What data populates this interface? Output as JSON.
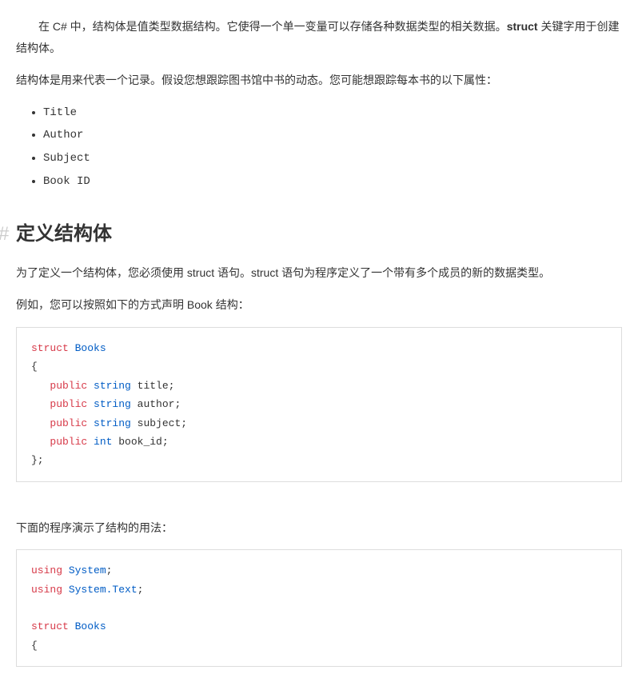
{
  "intro": {
    "p1_a": "在 C# 中，结构体是值类型数据结构。它使得一个单一变量可以存储各种数据类型的相关数据。",
    "p1_strong": "struct",
    "p1_b": " 关键字用于创建结构体。",
    "p2": "结构体是用来代表一个记录。假设您想跟踪图书馆中书的动态。您可能想跟踪每本书的以下属性：",
    "list": [
      "Title",
      "Author",
      "Subject",
      "Book ID"
    ]
  },
  "section": {
    "heading": "定义结构体",
    "p1": "为了定义一个结构体，您必须使用 struct 语句。struct 语句为程序定义了一个带有多个成员的新的数据类型。",
    "p2": "例如，您可以按照如下的方式声明 Book 结构：",
    "p3": "下面的程序演示了结构的用法："
  },
  "code1": {
    "l1_kw": "struct",
    "l1_type": "Books",
    "l2": "{",
    "l3_kw": "public",
    "l3_type": "string",
    "l3_id": "title;",
    "l4_kw": "public",
    "l4_type": "string",
    "l4_id": "author;",
    "l5_kw": "public",
    "l5_type": "string",
    "l5_id": "subject;",
    "l6_kw": "public",
    "l6_type": "int",
    "l6_id": "book_id;",
    "l7": "};"
  },
  "code2": {
    "l1_kw": "using",
    "l1_type": "System",
    "l1_end": ";",
    "l2_kw": "using",
    "l2_type": "System.Text",
    "l2_end": ";",
    "blank": "",
    "l3_kw": "struct",
    "l3_type": "Books",
    "l4": "{"
  }
}
